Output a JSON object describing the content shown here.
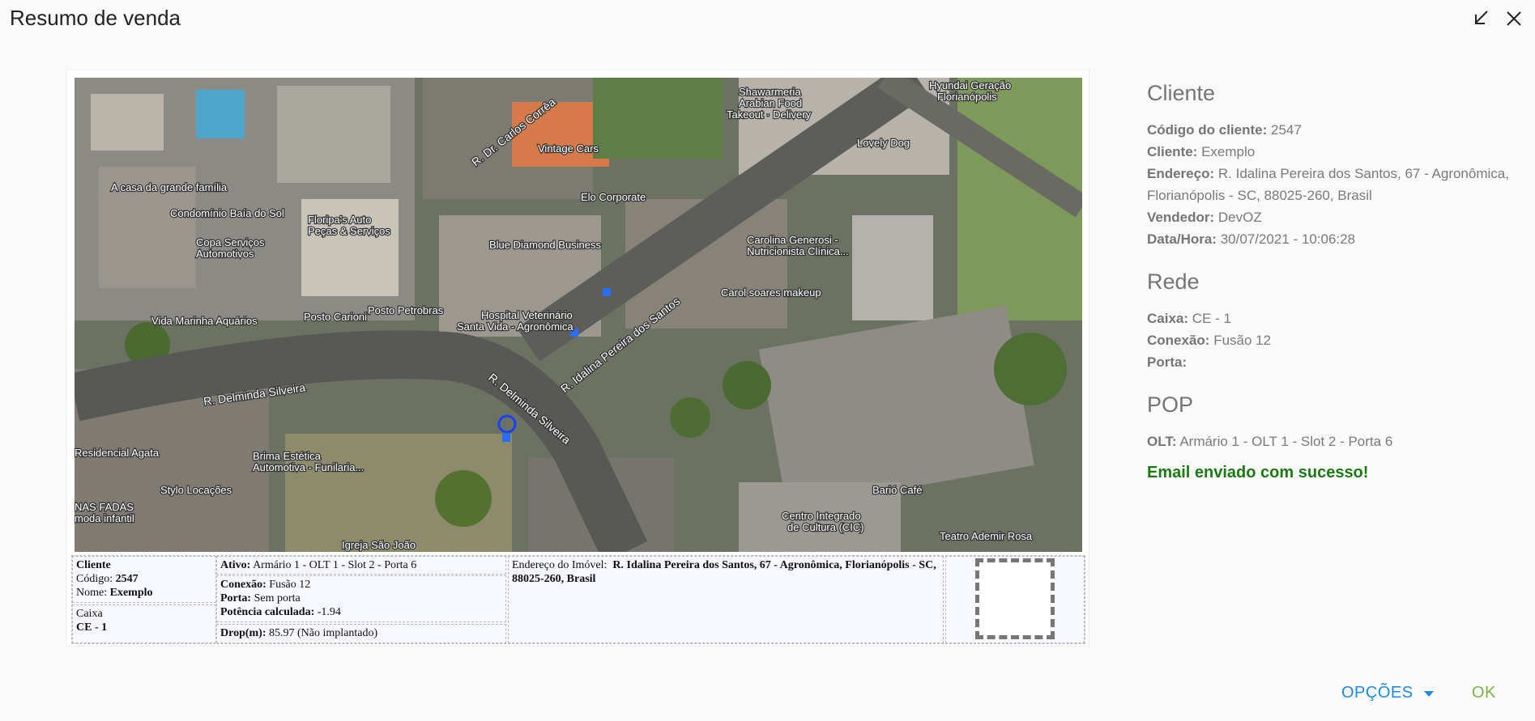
{
  "window": {
    "title": "Resumo de venda",
    "minimize_icon": "arrow-diagonal-icon",
    "close_icon": "close-icon"
  },
  "map": {
    "labels": [
      "Shawarmeria Arabian Food",
      "Takeout · Delivery",
      "Hyundai Geração Florianópolis",
      "R. Dr. Carlos Corrêa",
      "Vintage Cars",
      "Lovely Dog",
      "A casa da grande família",
      "Condomínio Baía do Sol",
      "Elo Corporate",
      "Floripa's Auto Peças & Serviços",
      "Copa Serviços Automotivos",
      "Blue Diamond Business",
      "Carolina Generosi - Nutricionista Clínica...",
      "Carol soares makeup",
      "Vida Marinha Aquários",
      "Posto Carioni",
      "Posto Petrobras",
      "Hospital Veterinário Santa Vida - Agronômica",
      "R. Idalina Pereira dos Santos",
      "R. Delminda Silveira",
      "R. Delminda Silveira",
      "Residencial Agata",
      "Brima Estética Automotiva - Funilaria...",
      "Stylo Locações",
      "NAS FADAS moda infantil",
      "Igreja São João",
      "Barió Café",
      "Centro Integrado de Cultura (CIC)",
      "Teatro Ademir Rosa - Teatro do CIC"
    ]
  },
  "info": {
    "cliente_title": "Cliente",
    "codigo_label": "Código:",
    "codigo_value": "2547",
    "nome_label": "Nome:",
    "nome_value": "Exemplo",
    "caixa_title": "Caixa",
    "caixa_value": "CE - 1",
    "ativo_label": "Ativo:",
    "ativo_value": "Armário 1 - OLT 1 - Slot 2 - Porta 6",
    "conexao_label": "Conexão:",
    "conexao_value": "Fusão 12",
    "porta_label": "Porta:",
    "porta_value": "Sem porta",
    "potencia_label": "Potência calculada:",
    "potencia_value": "-1.94",
    "drop_label": "Drop(m):",
    "drop_value": "85.97 (Não implantado)",
    "endereco_label": "Endereço do Imóvel:",
    "endereco_value": "R. Idalina Pereira dos Santos, 67 - Agronômica, Florianópolis - SC, 88025-260, Brasil"
  },
  "panel": {
    "cliente_heading": "Cliente",
    "codigo_label": "Código do cliente:",
    "codigo_value": "2547",
    "cliente_label": "Cliente:",
    "cliente_value": "Exemplo",
    "endereco_label": "Endereço:",
    "endereco_value": "R. Idalina Pereira dos Santos, 67 - Agronômica, Florianópolis - SC, 88025-260, Brasil",
    "vendedor_label": "Vendedor:",
    "vendedor_value": "DevOZ",
    "datahora_label": "Data/Hora:",
    "datahora_value": "30/07/2021 - 10:06:28",
    "rede_heading": "Rede",
    "caixa_label": "Caixa:",
    "caixa_value": "CE - 1",
    "conexao_label": "Conexão:",
    "conexao_value": "Fusão 12",
    "porta_label": "Porta:",
    "porta_value": "",
    "pop_heading": "POP",
    "olt_label": "OLT:",
    "olt_value": "Armário 1 - OLT 1 - Slot 2 - Porta 6",
    "success_message": "Email enviado com sucesso!"
  },
  "actions": {
    "options_label": "OPÇÕES",
    "ok_label": "OK",
    "options_color": "#1e88e5",
    "ok_color": "#7cb342"
  }
}
